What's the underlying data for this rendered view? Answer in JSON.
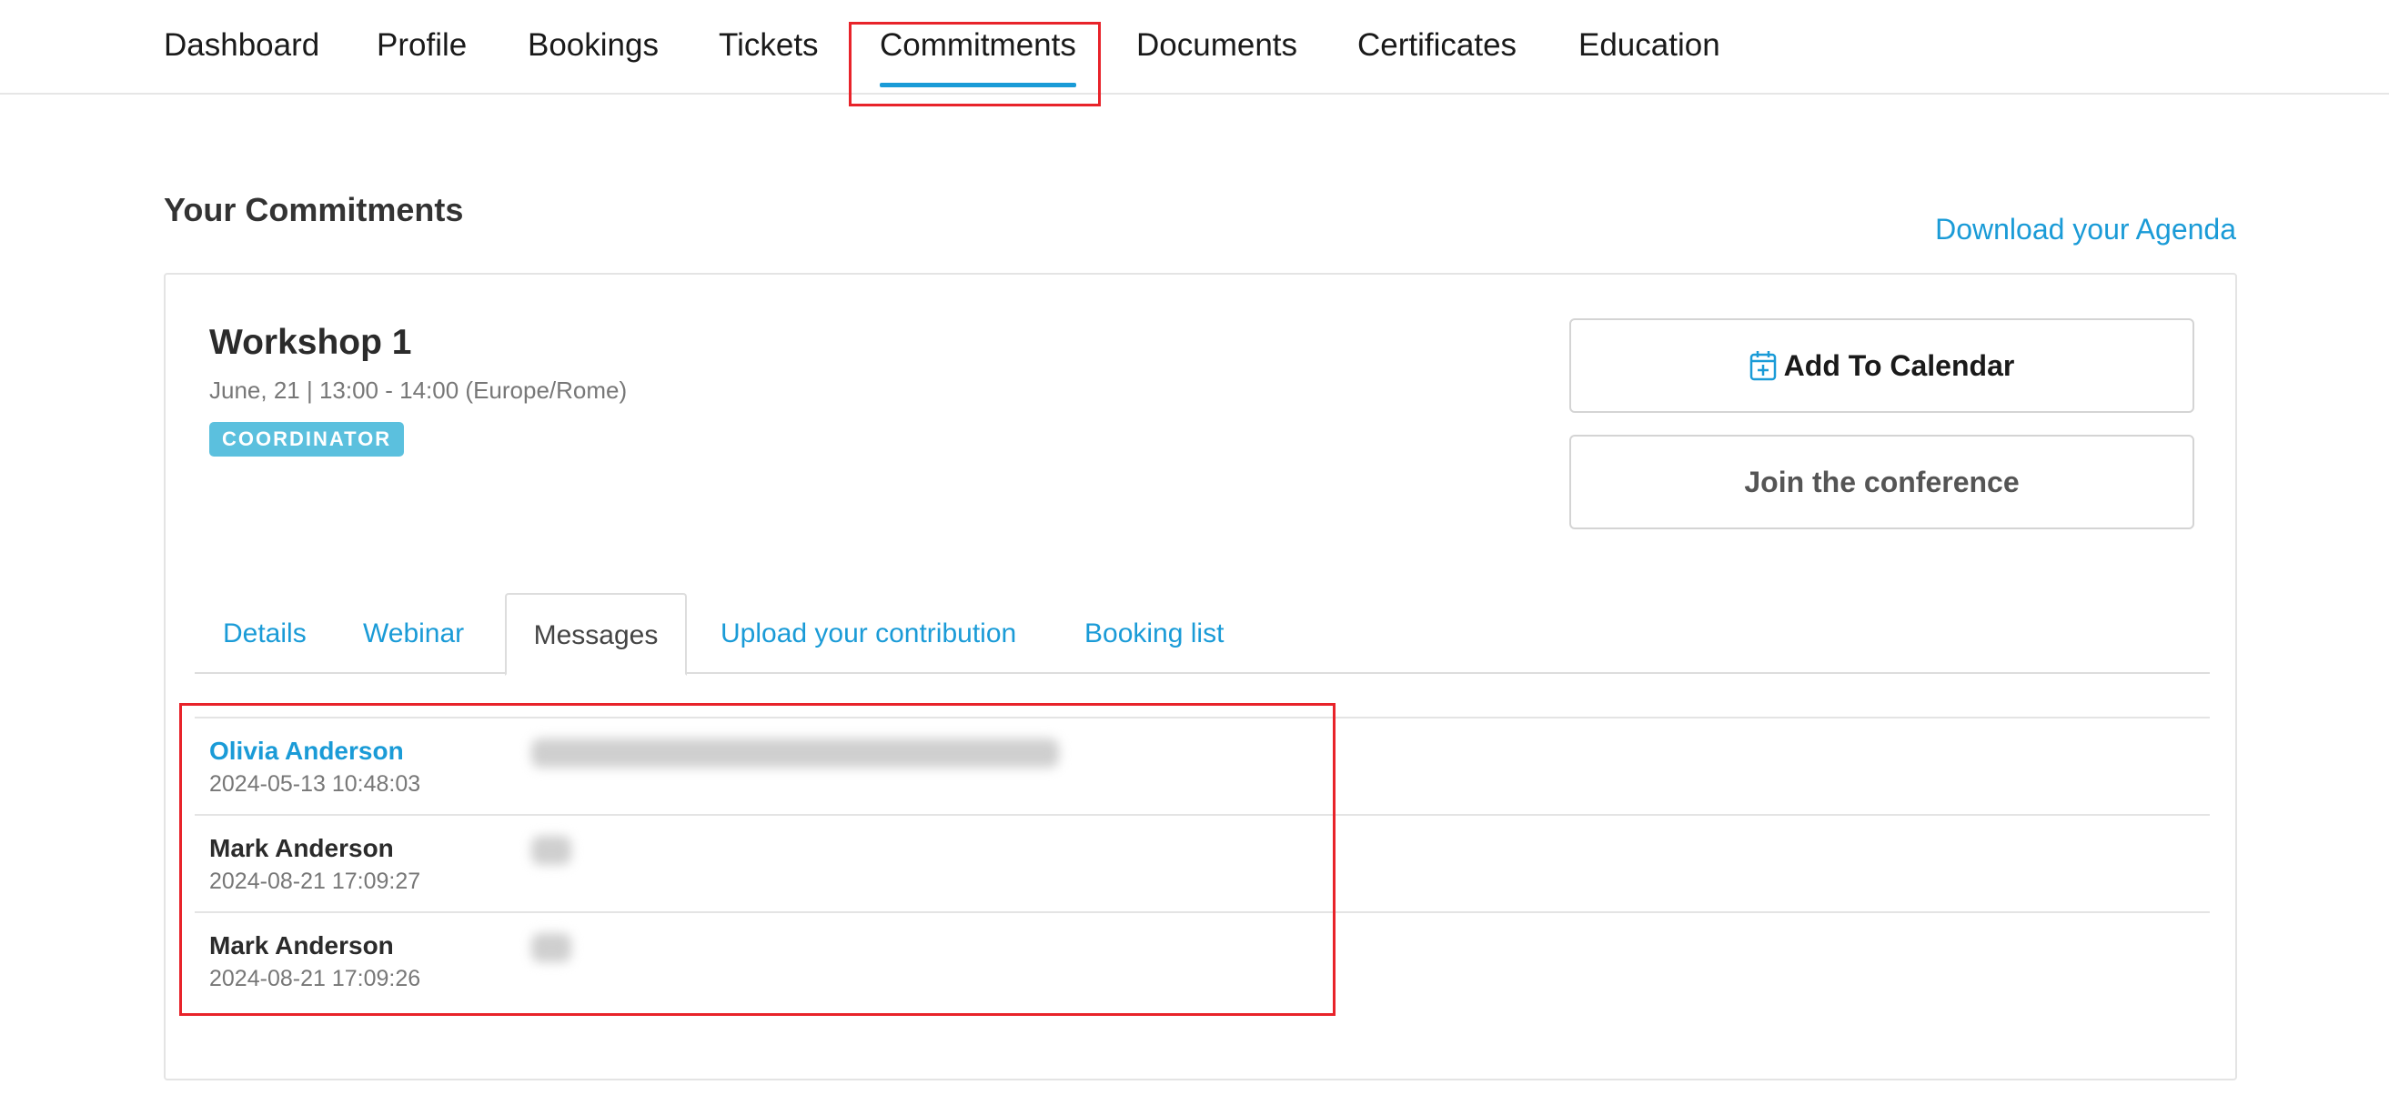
{
  "nav": {
    "items": [
      {
        "label": "Dashboard"
      },
      {
        "label": "Profile"
      },
      {
        "label": "Bookings"
      },
      {
        "label": "Tickets"
      },
      {
        "label": "Commitments"
      },
      {
        "label": "Documents"
      },
      {
        "label": "Certificates"
      },
      {
        "label": "Education"
      }
    ],
    "active": "Commitments"
  },
  "page": {
    "title": "Your Commitments",
    "agenda_link": "Download your Agenda"
  },
  "event": {
    "title": "Workshop 1",
    "date": "June, 21 | 13:00 - 14:00 (Europe/Rome)",
    "role": "COORDINATOR",
    "add_calendar_label": "Add To Calendar",
    "join_label": "Join the conference"
  },
  "tabs": [
    {
      "label": "Details"
    },
    {
      "label": "Webinar"
    },
    {
      "label": "Messages"
    },
    {
      "label": "Upload your contribution"
    },
    {
      "label": "Booking list"
    }
  ],
  "active_tab": "Messages",
  "messages": [
    {
      "author": "Olivia Anderson",
      "time": "2024-05-13 10:48:03"
    },
    {
      "author": "Mark Anderson",
      "time": "2024-08-21 17:09:27"
    },
    {
      "author": "Mark Anderson",
      "time": "2024-08-21 17:09:26"
    }
  ],
  "colors": {
    "accent": "#1a9bd7",
    "badge": "#5bc0de",
    "highlight": "#e8232a"
  }
}
